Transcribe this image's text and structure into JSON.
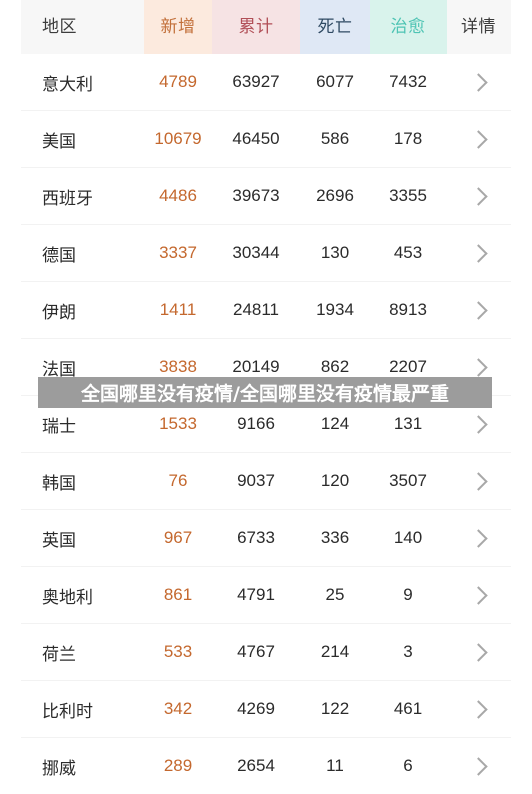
{
  "table": {
    "columns": [
      {
        "key": "region",
        "label": "地区",
        "header_bg": "#f7f7f7",
        "text_color": "#3c3c3c"
      },
      {
        "key": "new",
        "label": "新增",
        "header_bg": "#fceade",
        "text_color": "#c2703a"
      },
      {
        "key": "total",
        "label": "累计",
        "header_bg": "#f6e3e4",
        "text_color": "#b14f57"
      },
      {
        "key": "death",
        "label": "死亡",
        "header_bg": "#dfe8f5",
        "text_color": "#2f4a63"
      },
      {
        "key": "cured",
        "label": "治愈",
        "header_bg": "#d9f3ec",
        "text_color": "#4fc4b4"
      },
      {
        "key": "detail",
        "label": "详情",
        "header_bg": "#f7f7f7",
        "text_color": "#3c3c3c"
      }
    ],
    "rows": [
      {
        "region": "意大利",
        "new": "4789",
        "total": "63927",
        "death": "6077",
        "cured": "7432",
        "detail_icon": "chevron-right-icon"
      },
      {
        "region": "美国",
        "new": "10679",
        "total": "46450",
        "death": "586",
        "cured": "178",
        "detail_icon": "chevron-right-icon"
      },
      {
        "region": "西班牙",
        "new": "4486",
        "total": "39673",
        "death": "2696",
        "cured": "3355",
        "detail_icon": "chevron-right-icon"
      },
      {
        "region": "德国",
        "new": "3337",
        "total": "30344",
        "death": "130",
        "cured": "453",
        "detail_icon": "chevron-right-icon"
      },
      {
        "region": "伊朗",
        "new": "1411",
        "total": "24811",
        "death": "1934",
        "cured": "8913",
        "detail_icon": "chevron-right-icon"
      },
      {
        "region": "法国",
        "new": "3838",
        "total": "20149",
        "death": "862",
        "cured": "2207",
        "detail_icon": "chevron-right-icon"
      },
      {
        "region": "瑞士",
        "new": "1533",
        "total": "9166",
        "death": "124",
        "cured": "131",
        "detail_icon": "chevron-right-icon"
      },
      {
        "region": "韩国",
        "new": "76",
        "total": "9037",
        "death": "120",
        "cured": "3507",
        "detail_icon": "chevron-right-icon"
      },
      {
        "region": "英国",
        "new": "967",
        "total": "6733",
        "death": "336",
        "cured": "140",
        "detail_icon": "chevron-right-icon"
      },
      {
        "region": "奥地利",
        "new": "861",
        "total": "4791",
        "death": "25",
        "cured": "9",
        "detail_icon": "chevron-right-icon"
      },
      {
        "region": "荷兰",
        "new": "533",
        "total": "4767",
        "death": "214",
        "cured": "3",
        "detail_icon": "chevron-right-icon"
      },
      {
        "region": "比利时",
        "new": "342",
        "total": "4269",
        "death": "122",
        "cured": "461",
        "detail_icon": "chevron-right-icon"
      },
      {
        "region": "挪威",
        "new": "289",
        "total": "2654",
        "death": "11",
        "cured": "6",
        "detail_icon": "chevron-right-icon"
      }
    ]
  },
  "watermark": {
    "text": "全国哪里没有疫情/全国哪里没有疫情最严重",
    "bar_color": "#9c9c9c",
    "text_color": "#ffffff"
  },
  "colors": {
    "new_value": "#c4682e",
    "value_text": "#2b2b2b",
    "row_divider": "#f2f2f2",
    "chevron": "#a8a8a8",
    "page_bg": "#ffffff"
  }
}
